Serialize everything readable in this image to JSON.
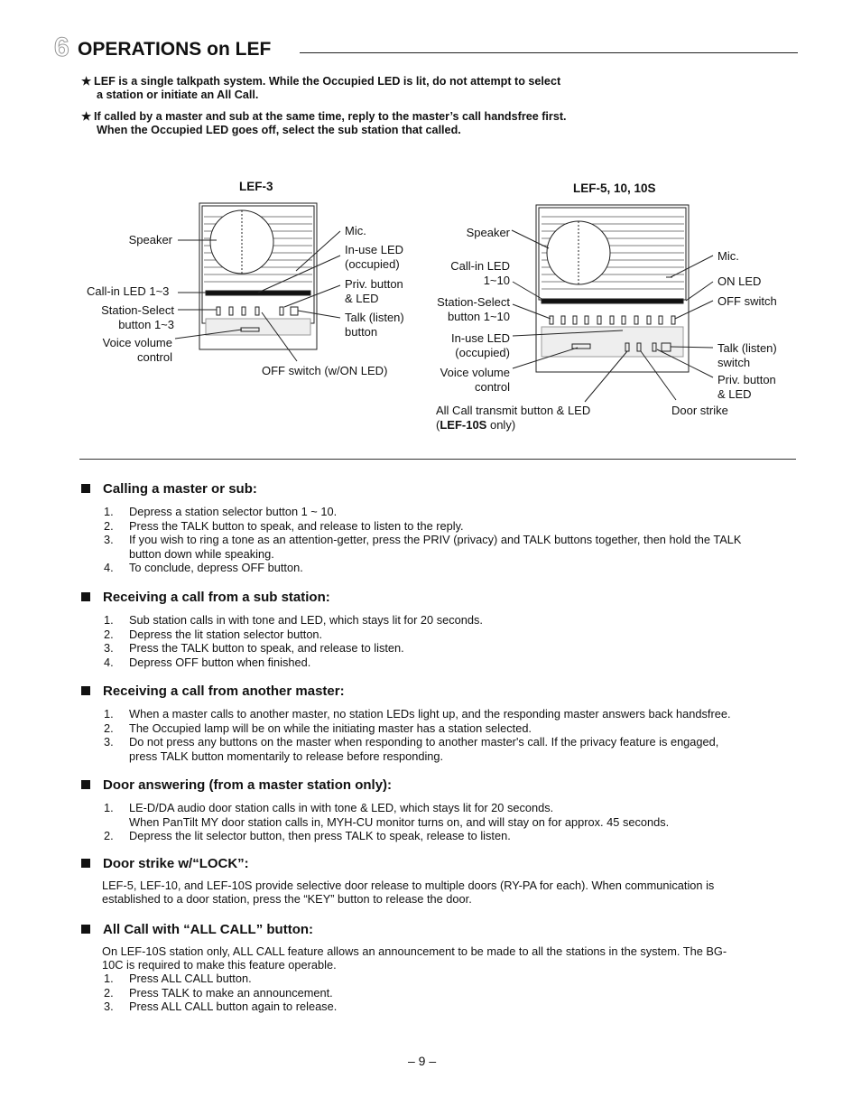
{
  "header": {
    "number": "6",
    "title": "OPERATIONS on LEF"
  },
  "notes": [
    {
      "line1": "LEF is a single talkpath system.  While the Occupied LED is lit, do not attempt to select",
      "line2": "a station or initiate an All Call."
    },
    {
      "line1": "If called by a master and sub at the same time, reply to the master’s call handsfree first.",
      "line2": "When the Occupied LED goes off, select the sub station that called."
    }
  ],
  "star": "★",
  "diagram_lef3": {
    "title": "LEF-3",
    "labels": {
      "speaker": "Speaker",
      "call_in": "Call-in LED 1~3",
      "station_select_1": "Station-Select",
      "station_select_2": "button 1~3",
      "volume_1": "Voice volume",
      "volume_2": "control",
      "mic": "Mic.",
      "inuse_1": "In-use LED",
      "inuse_2": "(occupied)",
      "priv_1": "Priv. button",
      "priv_2": "& LED",
      "talk_1": "Talk (listen)",
      "talk_2": "button",
      "off": "OFF switch (w/ON LED)"
    }
  },
  "diagram_lef5": {
    "title": "LEF-5, 10, 10S",
    "labels": {
      "speaker": "Speaker",
      "call_in_1": "Call-in LED",
      "call_in_2": "1~10",
      "station_select_1": "Station-Select",
      "station_select_2": "button 1~10",
      "inuse_1": "In-use LED",
      "inuse_2": "(occupied)",
      "volume_1": "Voice volume",
      "volume_2": "control",
      "allcall_1": "All Call transmit button  & LED",
      "allcall_2a": "(",
      "allcall_2b": "LEF-10S",
      "allcall_2c": " only)",
      "mic": "Mic.",
      "on_led": "ON LED",
      "off": "OFF switch",
      "talk_1": "Talk (listen)",
      "talk_2": "switch",
      "priv_1": "Priv. button",
      "priv_2": "& LED",
      "door": "Door strike"
    }
  },
  "sections": [
    {
      "heading": "Calling a master or sub:",
      "items": [
        {
          "n": "1.",
          "lines": [
            "Depress a station selector button 1 ~ 10."
          ]
        },
        {
          "n": "2.",
          "lines": [
            "Press the TALK button to speak, and release to listen to the reply."
          ]
        },
        {
          "n": "3.",
          "lines": [
            "If you wish to ring a tone as an attention-getter, press the PRIV (privacy) and TALK buttons together, then hold the TALK",
            "button down while speaking."
          ]
        },
        {
          "n": "4.",
          "lines": [
            "To conclude, depress OFF button."
          ]
        }
      ]
    },
    {
      "heading": "Receiving a call from a sub station:",
      "items": [
        {
          "n": "1.",
          "lines": [
            "Sub station calls in with tone and LED, which stays lit for 20 seconds."
          ]
        },
        {
          "n": "2.",
          "lines": [
            "Depress the lit station selector button."
          ]
        },
        {
          "n": "3.",
          "lines": [
            "Press the TALK button to speak, and release to listen."
          ]
        },
        {
          "n": "4.",
          "lines": [
            "Depress OFF button when finished."
          ]
        }
      ]
    },
    {
      "heading": "Receiving a call from another master:",
      "items": [
        {
          "n": "1.",
          "lines": [
            "When a master calls to another master, no station LEDs light up, and the responding master answers back handsfree."
          ]
        },
        {
          "n": "2.",
          "lines": [
            "The Occupied lamp will be on while the initiating master has a station selected."
          ]
        },
        {
          "n": "3.",
          "lines": [
            "Do not press any buttons on the master when responding to another master's call.  If the privacy feature is engaged,",
            "press TALK button momentarily to release before responding."
          ]
        }
      ]
    },
    {
      "heading": "Door answering (from a master station only):",
      "items": [
        {
          "n": "1.",
          "lines": [
            "LE-D/DA audio door station calls in with tone & LED, which stays lit for 20 seconds.",
            "When PanTilt MY door station calls in, MYH-CU monitor turns on, and will stay on for approx. 45 seconds."
          ]
        },
        {
          "n": "2.",
          "lines": [
            "Depress the lit selector button, then press TALK to speak, release to listen."
          ]
        }
      ]
    },
    {
      "heading": "Door strike w/“LOCK”:",
      "para": [
        "LEF-5, LEF-10, and LEF-10S provide selective door release to multiple doors (RY-PA for each).  When communication is",
        "established to a door station, press the “KEY” button to release the door."
      ]
    },
    {
      "heading": "All Call with “ALL CALL” button:",
      "para": [
        "On LEF-10S station only, ALL CALL feature allows an announcement to be made to all the stations in the system.  The BG-",
        "10C is required to make this feature operable."
      ],
      "items": [
        {
          "n": "1.",
          "lines": [
            "Press ALL CALL button."
          ]
        },
        {
          "n": "2.",
          "lines": [
            "Press TALK to make an announcement."
          ]
        },
        {
          "n": "3.",
          "lines": [
            "Press ALL CALL button again to release."
          ]
        }
      ]
    }
  ],
  "footer": {
    "page": "– 9 –"
  }
}
